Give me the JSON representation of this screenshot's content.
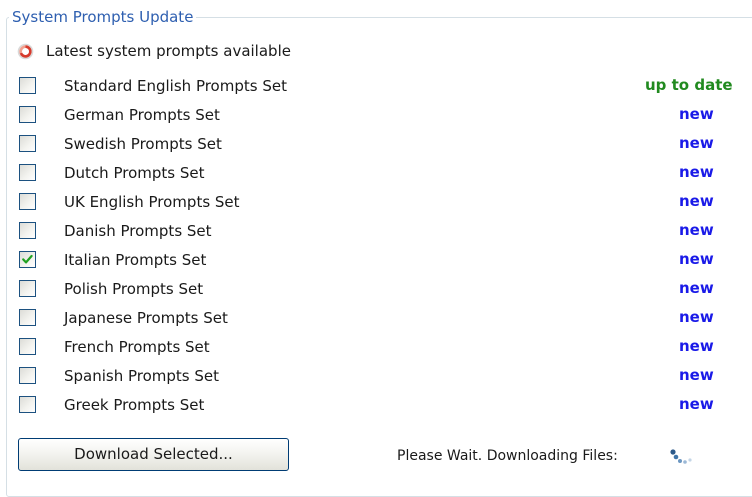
{
  "group": {
    "title": "System Prompts Update"
  },
  "status": {
    "text": "Latest system prompts available",
    "icon": "refresh-icon"
  },
  "colors": {
    "title": "#2e5fb0",
    "new": "#1a1ae8",
    "up_to_date": "#218a1f",
    "checkmark": "#21a121"
  },
  "prompt_sets": [
    {
      "label": "Standard English Prompts Set",
      "status": "up to date",
      "checked": false
    },
    {
      "label": "German Prompts Set",
      "status": "new",
      "checked": false
    },
    {
      "label": "Swedish Prompts Set",
      "status": "new",
      "checked": false
    },
    {
      "label": "Dutch Prompts Set",
      "status": "new",
      "checked": false
    },
    {
      "label": "UK English Prompts Set",
      "status": "new",
      "checked": false
    },
    {
      "label": "Danish Prompts Set",
      "status": "new",
      "checked": false
    },
    {
      "label": "Italian Prompts Set",
      "status": "new",
      "checked": true
    },
    {
      "label": "Polish Prompts Set",
      "status": "new",
      "checked": false
    },
    {
      "label": "Japanese Prompts Set",
      "status": "new",
      "checked": false
    },
    {
      "label": "French Prompts Set",
      "status": "new",
      "checked": false
    },
    {
      "label": "Spanish Prompts Set",
      "status": "new",
      "checked": false
    },
    {
      "label": "Greek Prompts Set",
      "status": "new",
      "checked": false
    }
  ],
  "footer": {
    "download_label": "Download Selected...",
    "wait_text": "Please Wait. Downloading Files:",
    "spinner_icon": "loading-spinner-icon"
  }
}
